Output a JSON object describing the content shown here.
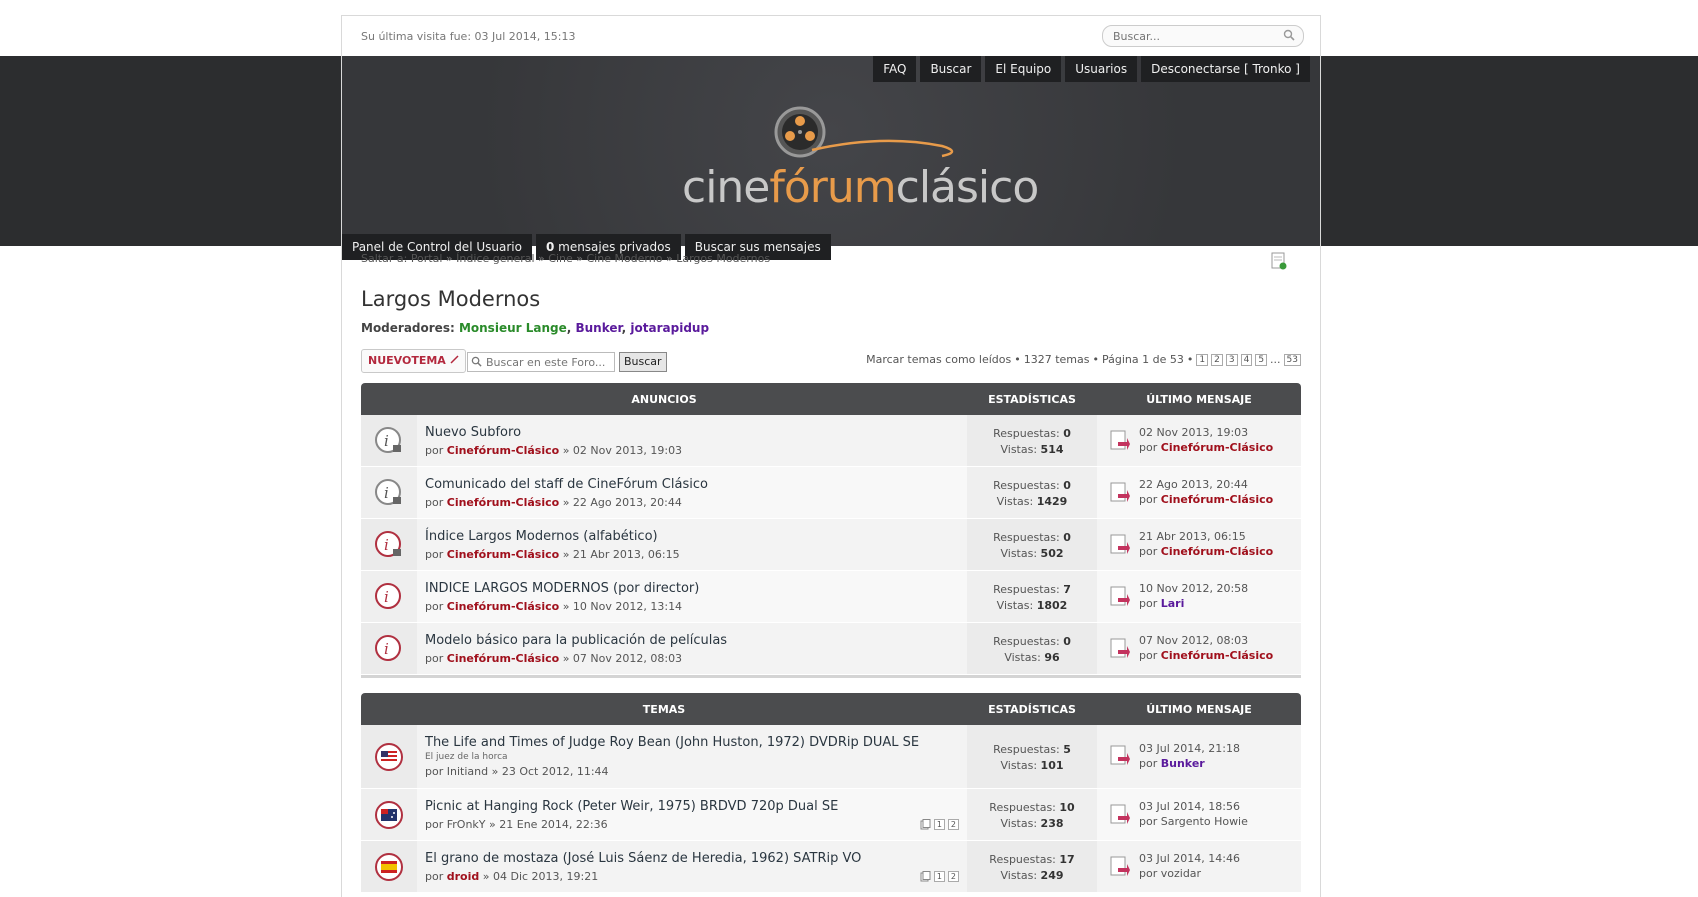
{
  "topbar": {
    "last_visit": "Su última visita fue: 03 Jul 2014, 15:13",
    "search_placeholder": "Buscar..."
  },
  "topnav": [
    "FAQ",
    "Buscar",
    "El Equipo",
    "Usuarios",
    "Desconectarse [ Tronko ]"
  ],
  "logo": {
    "part1": "cine",
    "part2": "fórum",
    "part3": "clásico"
  },
  "subnav": {
    "ucp": "Panel de Control del Usuario",
    "pm_count": "0",
    "pm_label": " mensajes privados",
    "search_own": "Buscar sus mensajes"
  },
  "breadcrumb": {
    "prefix": "Saltar a:",
    "items": [
      "Portal",
      "Índice general",
      "Cine",
      "Cine Moderno",
      "Largos Modernos"
    ]
  },
  "forum": {
    "title": "Largos Modernos",
    "moderators_label": "Moderadores:",
    "moderators": [
      "Monsieur Lange",
      "Bunker",
      "jotarapidup"
    ]
  },
  "actions": {
    "new_topic": "NUEVOTEMA",
    "search_placeholder": "Buscar en este Foro...",
    "search_button": "Buscar"
  },
  "pagination": {
    "mark_read": "Marcar temas como leídos",
    "topic_count": "1327 temas",
    "page_info": "Página 1 de 53",
    "pages": [
      "1",
      "2",
      "3",
      "4",
      "5"
    ],
    "ellipsis": "...",
    "last": "53"
  },
  "announcements": {
    "header": "ANUNCIOS",
    "stats_header": "ESTADÍSTICAS",
    "last_header": "ÚLTIMO MENSAJE",
    "rows": [
      {
        "title": "Nuevo Subforo",
        "by": "por",
        "author": "Cinefórum-Clásico",
        "date": "» 02 Nov 2013, 19:03",
        "replies_label": "Respuestas:",
        "replies": "0",
        "views_label": "Vistas:",
        "views": "514",
        "last_date": "02 Nov 2013, 19:03",
        "last_by": "por",
        "last_author": "Cinefórum-Clásico"
      },
      {
        "title": "Comunicado del staff de CineFórum Clásico",
        "by": "por",
        "author": "Cinefórum-Clásico",
        "date": "» 22 Ago 2013, 20:44",
        "replies_label": "Respuestas:",
        "replies": "0",
        "views_label": "Vistas:",
        "views": "1429",
        "last_date": "22 Ago 2013, 20:44",
        "last_by": "por",
        "last_author": "Cinefórum-Clásico"
      },
      {
        "title": "Índice Largos Modernos (alfabético)",
        "by": "por",
        "author": "Cinefórum-Clásico",
        "date": "» 21 Abr 2013, 06:15",
        "replies_label": "Respuestas:",
        "replies": "0",
        "views_label": "Vistas:",
        "views": "502",
        "last_date": "21 Abr 2013, 06:15",
        "last_by": "por",
        "last_author": "Cinefórum-Clásico"
      },
      {
        "title": "INDICE LARGOS MODERNOS (por director)",
        "by": "por",
        "author": "Cinefórum-Clásico",
        "date": "» 10 Nov 2012, 13:14",
        "replies_label": "Respuestas:",
        "replies": "7",
        "views_label": "Vistas:",
        "views": "1802",
        "last_date": "10 Nov 2012, 20:58",
        "last_by": "por",
        "last_author": "Lari"
      },
      {
        "title": "Modelo básico para la publicación de películas",
        "by": "por",
        "author": "Cinefórum-Clásico",
        "date": "» 07 Nov 2012, 08:03",
        "replies_label": "Respuestas:",
        "replies": "0",
        "views_label": "Vistas:",
        "views": "96",
        "last_date": "07 Nov 2012, 08:03",
        "last_by": "por",
        "last_author": "Cinefórum-Clásico"
      }
    ]
  },
  "topics": {
    "header": "TEMAS",
    "stats_header": "ESTADÍSTICAS",
    "last_header": "ÚLTIMO MENSAJE",
    "rows": [
      {
        "title": "The Life and Times of Judge Roy Bean (John Huston, 1972) DVDRip DUAL SE",
        "subtitle": "El juez de la horca",
        "by": "por",
        "author": "Initiand",
        "date": "» 23 Oct 2012, 11:44",
        "replies_label": "Respuestas:",
        "replies": "5",
        "views_label": "Vistas:",
        "views": "101",
        "last_date": "03 Jul 2014, 21:18",
        "last_by": "por",
        "last_author": "Bunker"
      },
      {
        "title": "Picnic at Hanging Rock (Peter Weir, 1975) BRDVD 720p Dual SE",
        "by": "por",
        "author": "FrOnkY",
        "date": "» 21 Ene 2014, 22:36",
        "pages": [
          "1",
          "2"
        ],
        "replies_label": "Respuestas:",
        "replies": "10",
        "views_label": "Vistas:",
        "views": "238",
        "last_date": "03 Jul 2014, 18:56",
        "last_by": "por",
        "last_author": "Sargento Howie"
      },
      {
        "title": "El grano de mostaza (José Luis Sáenz de Heredia, 1962) SATRip VO",
        "by": "por",
        "author": "droid",
        "date": "» 04 Dic 2013, 19:21",
        "pages": [
          "1",
          "2"
        ],
        "replies_label": "Respuestas:",
        "replies": "17",
        "views_label": "Vistas:",
        "views": "249",
        "last_date": "03 Jul 2014, 14:46",
        "last_by": "por",
        "last_author": "vozidar"
      }
    ]
  },
  "colors": {
    "accent": "#e89b4a",
    "author_red": "#a0101c",
    "mod_green": "#2a8b2a",
    "mod_purple": "#5a1a9c"
  },
  "icons": [
    "search-icon",
    "rss-icon",
    "info-icon",
    "lock-icon",
    "flag-us-icon",
    "flag-au-icon",
    "flag-es-icon",
    "last-post-icon",
    "pencil-icon",
    "pages-icon",
    "film-reel-icon"
  ]
}
